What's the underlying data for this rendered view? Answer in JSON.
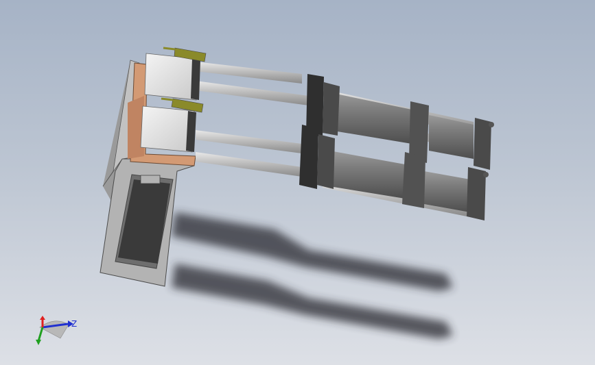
{
  "viewport": {
    "background_top": "#a6b3c6",
    "background_bottom": "#dde0e6"
  },
  "model": {
    "name": "",
    "parts": [
      "base-frame",
      "mounting-plate",
      "cylinder-assembly-upper",
      "cylinder-assembly-lower",
      "guide-block-upper",
      "guide-block-lower",
      "sensor-upper",
      "sensor-lower"
    ],
    "colors": {
      "frame": "#b0b0b0",
      "plate": "#d39a74",
      "cylinder": "#7a7a7a",
      "flange": "#3a3a3a",
      "sensor": "#8a8a2a",
      "shadow": "#2a2c30"
    }
  },
  "triad": {
    "axis_z_label": "Z",
    "icon": "coordinate-triad-icon",
    "colors": {
      "x": "#e02020",
      "y": "#20a020",
      "z": "#2030d0"
    }
  }
}
